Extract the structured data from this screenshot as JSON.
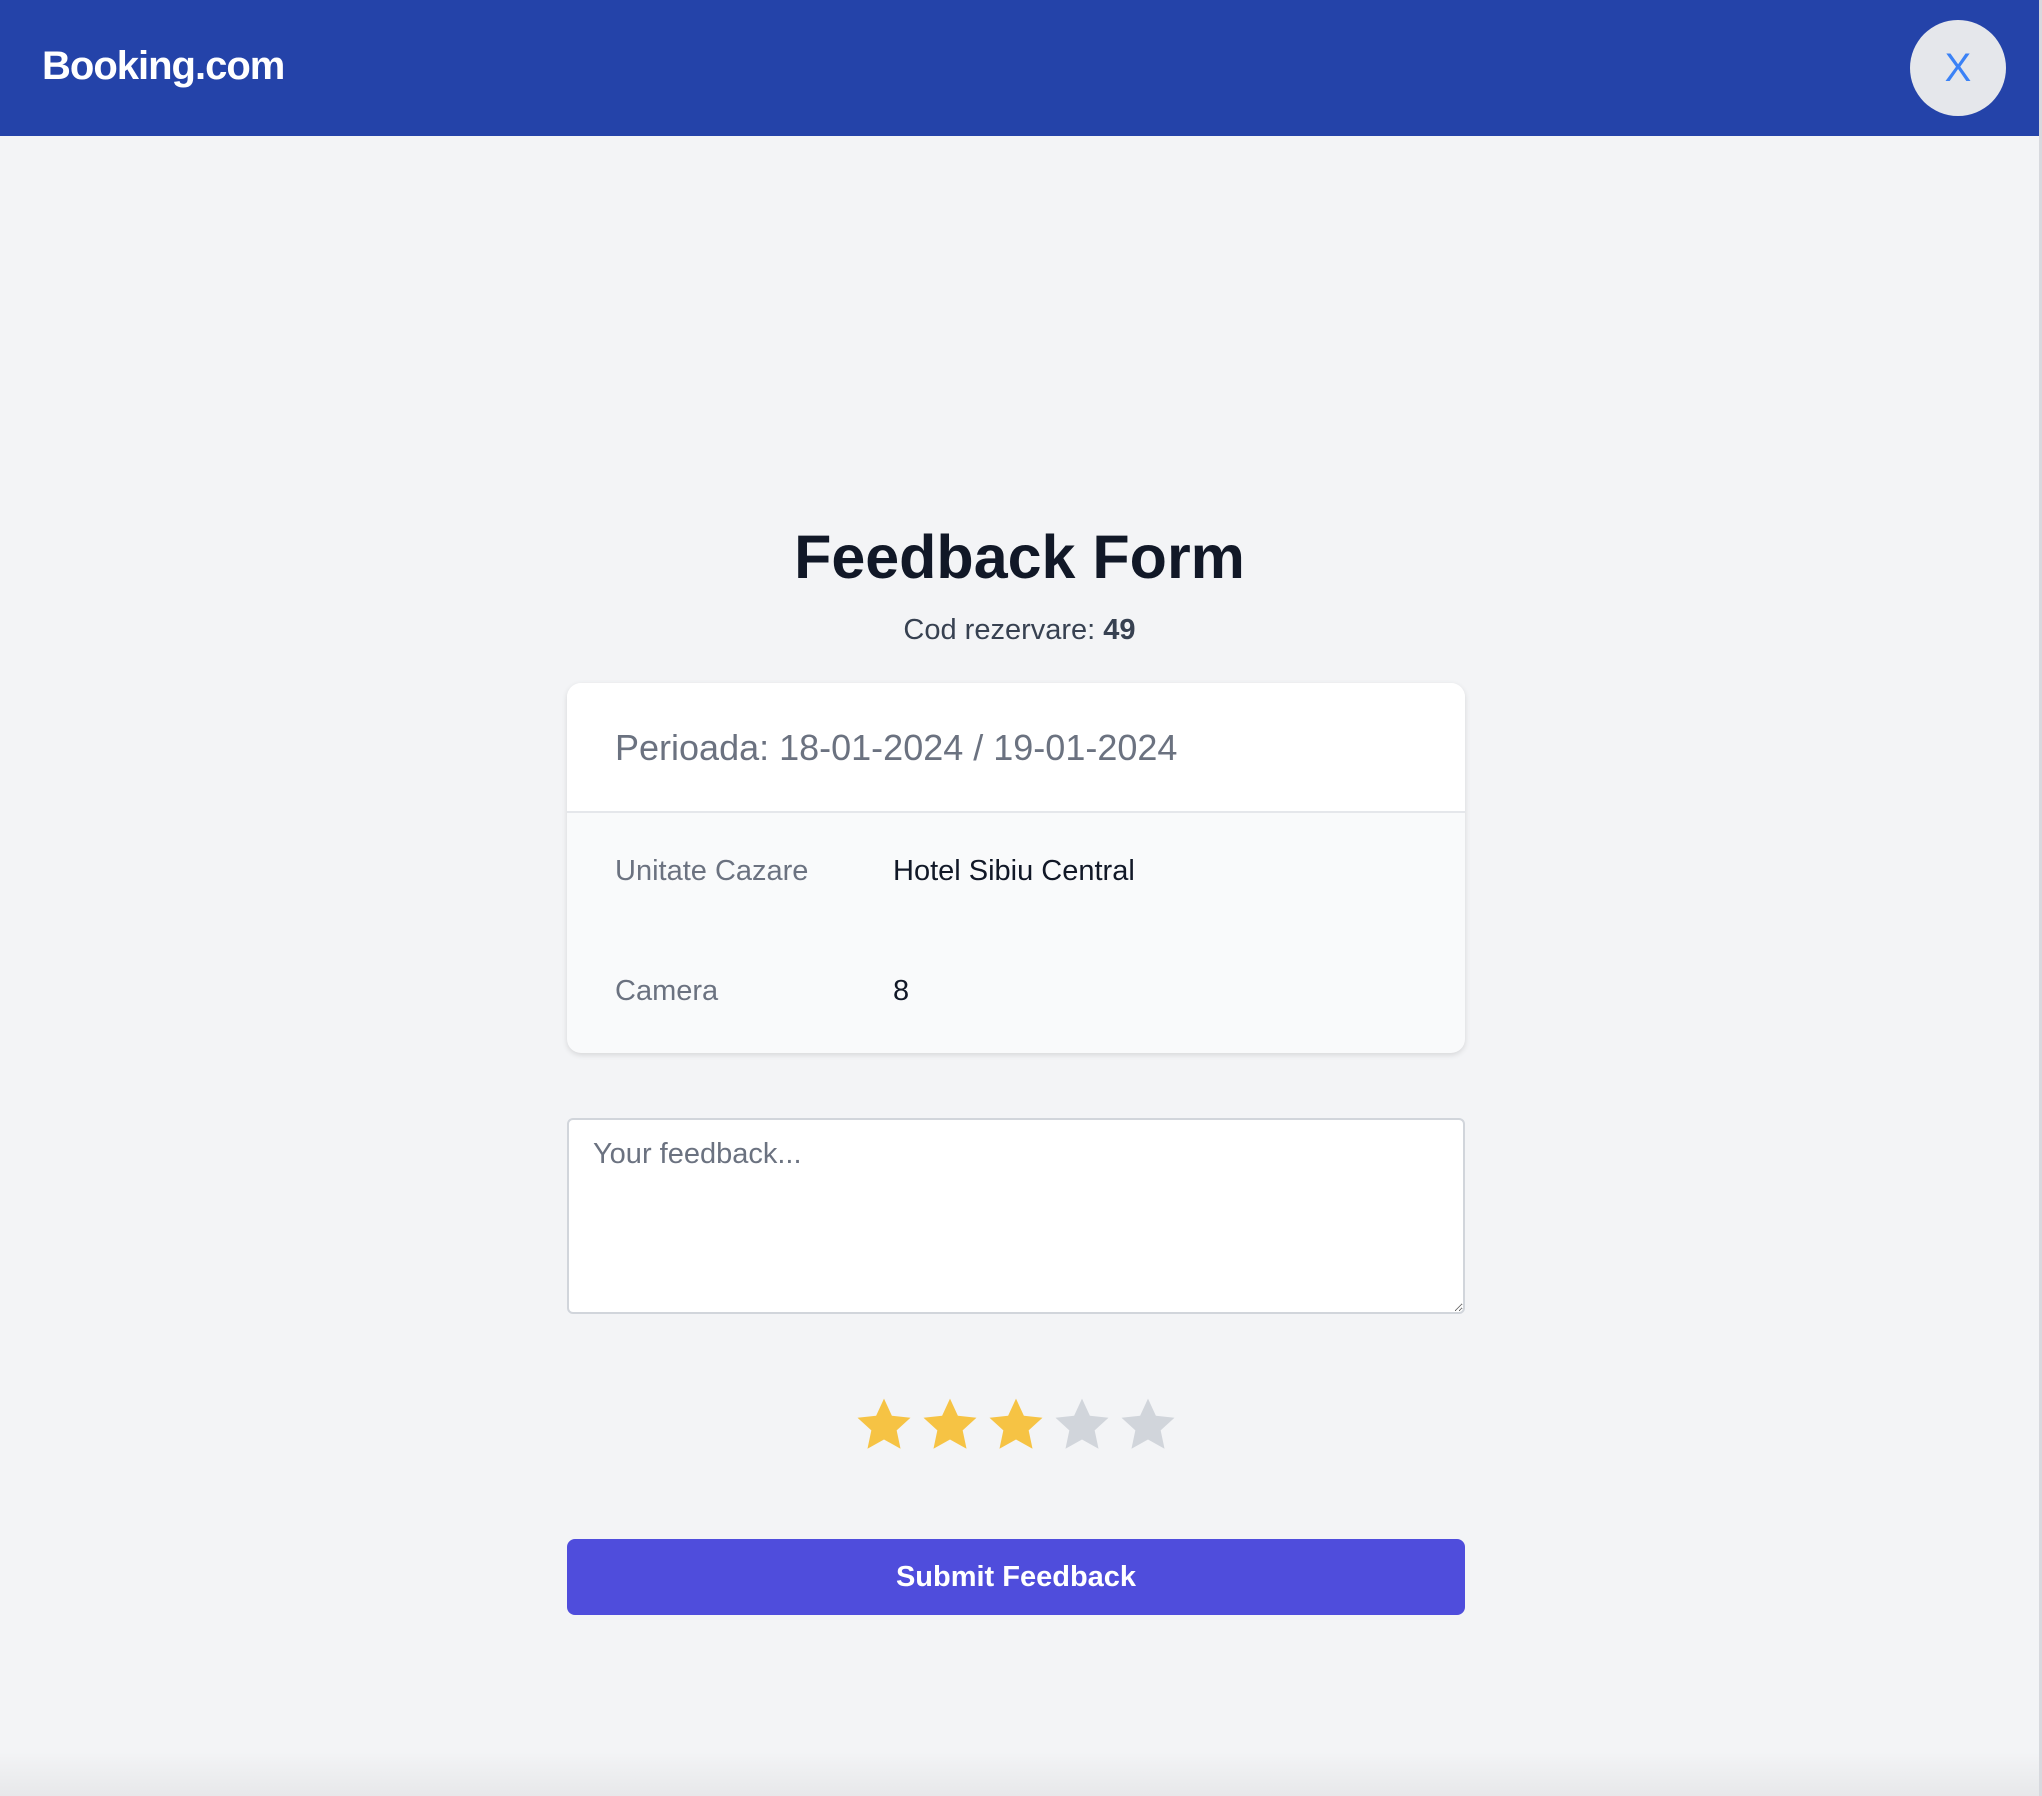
{
  "header": {
    "brand": "Booking.com",
    "close_label": "X"
  },
  "form": {
    "title": "Feedback Form",
    "booking_code_label": "Cod rezervare:",
    "booking_code_value": "49"
  },
  "details": {
    "period": "Perioada: 18-01-2024 / 19-01-2024",
    "rows": [
      {
        "label": "Unitate Cazare",
        "value": "Hotel Sibiu Central"
      },
      {
        "label": "Camera",
        "value": "8"
      }
    ]
  },
  "feedback": {
    "placeholder": "Your feedback...",
    "value": ""
  },
  "rating": {
    "value": 3,
    "max": 5,
    "filled_color": "#f6c344",
    "empty_color": "#d1d5db",
    "icon": "star-icon"
  },
  "submit": {
    "label": "Submit Feedback"
  },
  "colors": {
    "header_bg": "#2443a9",
    "button_bg": "#4f4ddc",
    "close_text": "#3b82f6"
  }
}
